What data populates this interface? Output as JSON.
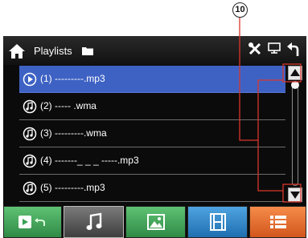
{
  "callout": {
    "number": "10"
  },
  "header": {
    "home_icon": "home-icon",
    "title": "Playlists",
    "folder_icon": "folder-icon",
    "tools_icon": "tools-icon",
    "display_icon": "monitor-icon",
    "back_icon": "back-icon"
  },
  "playlist": {
    "items": [
      {
        "label": "(1) ---------.mp3",
        "icon": "play-icon",
        "selected": true
      },
      {
        "label": "(2) ----- .wma",
        "icon": "music-note-icon",
        "selected": false
      },
      {
        "label": "(3) ---------.wma",
        "icon": "music-note-icon",
        "selected": false
      },
      {
        "label": "(4) -------_ _ _ -----.mp3",
        "icon": "music-note-icon",
        "selected": false
      },
      {
        "label": "(5) ---------.mp3",
        "icon": "music-note-icon",
        "selected": false
      }
    ]
  },
  "scrollbar": {
    "up_icon": "scroll-up-icon",
    "down_icon": "scroll-down-icon",
    "position": 0
  },
  "tabs": [
    {
      "name": "video-tab",
      "icon": "video-return-icon",
      "color": "#3aa056",
      "active": false
    },
    {
      "name": "music-tab",
      "icon": "music-note-icon",
      "color": "#5a5a5a",
      "active": true
    },
    {
      "name": "photo-tab",
      "icon": "photo-icon",
      "color": "#3aa056",
      "active": false
    },
    {
      "name": "movie-tab",
      "icon": "film-icon",
      "color": "#2f86c8",
      "active": false
    },
    {
      "name": "menu-tab",
      "icon": "list-menu-icon",
      "color": "#e06a2a",
      "active": false
    }
  ]
}
